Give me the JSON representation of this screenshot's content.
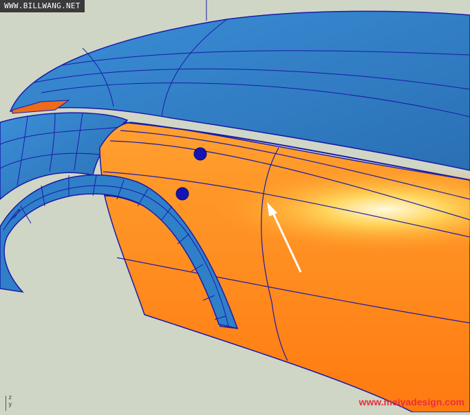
{
  "viewport": {
    "tag_text": "WWW.BILLWANG.NET",
    "axis_z": "z",
    "axis_y": "y",
    "watermark": "www.meiyadesign.com",
    "colors": {
      "background": "#cfd6c6",
      "surface_blue": "#2f80c9",
      "surface_orange": "#ff8a1c",
      "isocurve": "#1a1aa8",
      "point": "#1414b4",
      "arrow": "#ffffff",
      "watermark": "#e8303a"
    },
    "icons": [
      "control-point-icon",
      "arrow-pointer-icon"
    ]
  }
}
